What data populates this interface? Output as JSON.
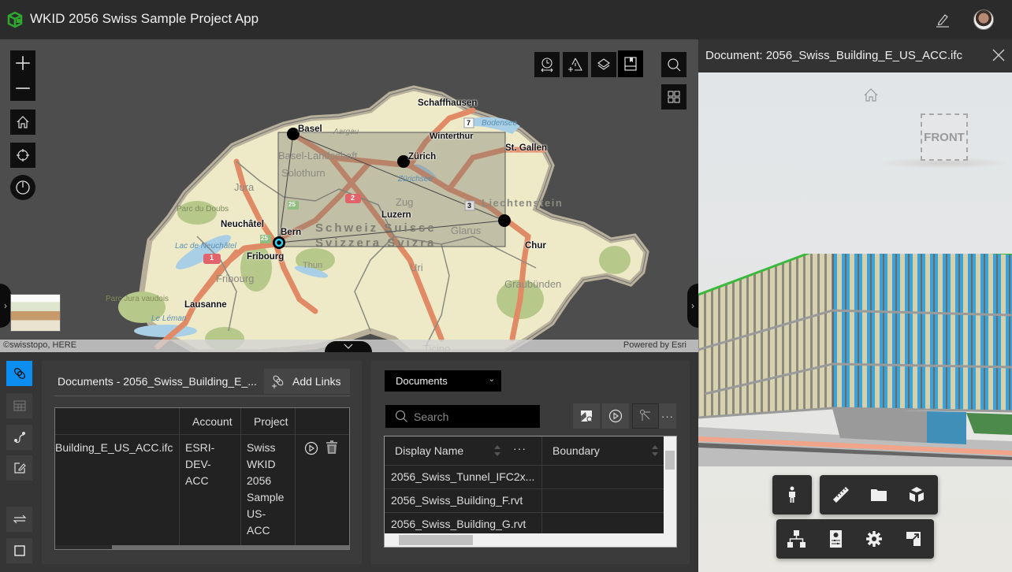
{
  "header": {
    "title": "WKID 2056 Swiss Sample Project App",
    "logo_icon": "cube-logo-icon",
    "edit_icon": "pencil-icon",
    "avatar_icon": "user-avatar"
  },
  "map": {
    "attribution_left": "©swisstopo, HERE",
    "attribution_right": "Powered by Esri",
    "left_tools": [
      {
        "name": "zoom-in",
        "icon": "plus-icon"
      },
      {
        "name": "zoom-out",
        "icon": "minus-icon"
      },
      {
        "name": "home",
        "icon": "home-icon"
      },
      {
        "name": "locate",
        "icon": "crosshair-icon"
      },
      {
        "name": "power",
        "icon": "power-icon"
      }
    ],
    "top_tools": [
      {
        "name": "time-slider",
        "icon": "clock-arrows-icon"
      },
      {
        "name": "add-alert",
        "icon": "warning-plus-icon"
      },
      {
        "name": "layers",
        "icon": "layers-icon"
      },
      {
        "name": "bookmarks",
        "icon": "bookmark-icon"
      },
      {
        "name": "search",
        "icon": "search-icon"
      },
      {
        "name": "basemap-gallery",
        "icon": "grid-icon"
      }
    ],
    "labels": {
      "cities": [
        "Schaffhausen",
        "Basel",
        "Winterthur",
        "St. Gallen",
        "Zürich",
        "Luzern",
        "Neuchâtel",
        "Bern",
        "Fribourg",
        "Chur",
        "Lausanne",
        "Thun"
      ],
      "regions": [
        "Basel-Landschaft",
        "Solothurn",
        "Jura",
        "Zug",
        "Glarus",
        "Liechtenstein",
        "Fribourg",
        "Graubünden",
        "Uri",
        "Aargau",
        "Ticino"
      ],
      "country": [
        "Schweiz Suisse",
        "Svizzera Svizra"
      ],
      "parks": [
        "Parc du Doubs",
        "Parc Jura vaudois"
      ],
      "lakes": [
        "Bodensee",
        "Zürichsee",
        "Lac de Neuchâtel",
        "Le Léman"
      ],
      "shields": [
        "7",
        "3",
        "2",
        "1",
        "25",
        "25"
      ]
    }
  },
  "left_rail": {
    "buttons": [
      {
        "name": "links",
        "icon": "link-icon",
        "active": true
      },
      {
        "name": "table",
        "icon": "table-icon",
        "active": false
      },
      {
        "name": "route",
        "icon": "route-icon",
        "active": false
      },
      {
        "name": "edit",
        "icon": "edit-square-icon",
        "active": false
      },
      {
        "name": "swap",
        "icon": "swap-arrows-icon",
        "active": false
      },
      {
        "name": "maximize",
        "icon": "square-icon",
        "active": false
      }
    ]
  },
  "documents_panel": {
    "title": "Documents - 2056_Swiss_Building_E_...",
    "add_links_label": "Add Links",
    "columns": [
      "",
      "Account",
      "Project",
      ""
    ],
    "rows": [
      {
        "name": "Building_E_US_ACC.ifc",
        "account_lines": [
          "ESRI-",
          "DEV-",
          "ACC"
        ],
        "project_lines": [
          "Swiss",
          "WKID",
          "2056",
          "Sample",
          "US-",
          "ACC"
        ]
      }
    ]
  },
  "feature_panel": {
    "dropdown_value": "Documents",
    "search_placeholder": "Search",
    "tool_icons": [
      "zoom-to-icon",
      "play-circle-icon",
      "relationship-icon",
      "more-icon"
    ],
    "columns": [
      "Display Name",
      "Boundary"
    ],
    "rows": [
      {
        "display_name": "2056_Swiss_Tunnel_IFC2x...",
        "boundary": ""
      },
      {
        "display_name": "2056_Swiss_Building_F.rvt",
        "boundary": ""
      },
      {
        "display_name": "2056_Swiss_Building_G.rvt",
        "boundary": ""
      }
    ]
  },
  "viewer": {
    "title": "Document: 2056_Swiss_Building_E_US_ACC.ifc",
    "viewcube_face": "FRONT",
    "toolbar_row1": [
      {
        "name": "first-person",
        "icon": "person-icon"
      },
      {
        "name": "measure",
        "icon": "ruler-icon"
      },
      {
        "name": "model-browser",
        "icon": "folder-icon"
      },
      {
        "name": "explode",
        "icon": "cube-explode-icon"
      }
    ],
    "toolbar_row2": [
      {
        "name": "structure",
        "icon": "hierarchy-icon"
      },
      {
        "name": "properties",
        "icon": "properties-icon"
      },
      {
        "name": "settings",
        "icon": "gear-icon"
      },
      {
        "name": "fullscreen",
        "icon": "fullscreen-icon"
      }
    ]
  },
  "colors": {
    "accent": "#0c8ef0",
    "header_bg": "#2b2b2b",
    "panel_bg": "#3b3b3b",
    "logo_green": "#2ea82e",
    "building_roof": "#3cb83c"
  }
}
